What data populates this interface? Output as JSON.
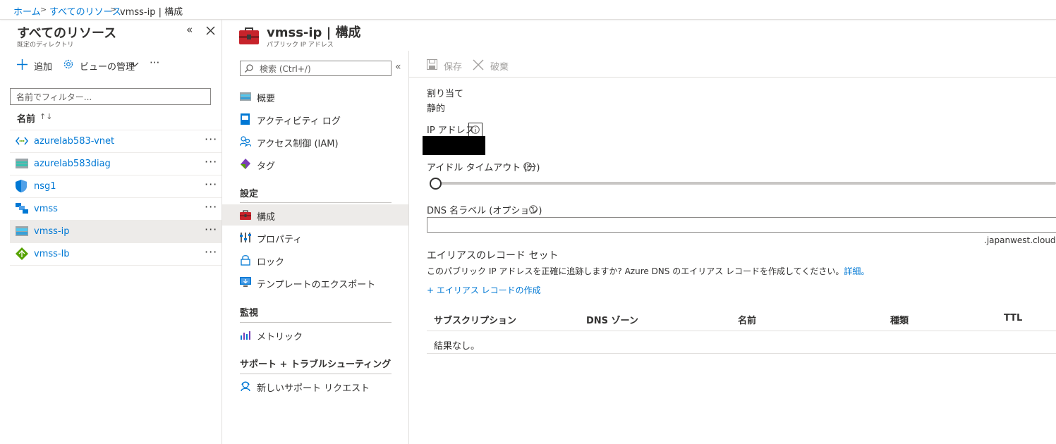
{
  "breadcrumb": {
    "home": "ホーム",
    "all_resources": "すべてのリソース",
    "current": "vmss-ip | 構成"
  },
  "left_pane": {
    "title": "すべてのリソース",
    "subtitle": "既定のディレクトリ",
    "add_label": "追加",
    "manage_view_label": "ビューの管理",
    "more": "···",
    "filter_placeholder": "名前でフィルター...",
    "name_header": "名前",
    "sort_icon": "↑↓",
    "resources": [
      {
        "name": "azurelab583-vnet",
        "icon": "vnet-icon"
      },
      {
        "name": "azurelab583diag",
        "icon": "storage-icon"
      },
      {
        "name": "nsg1",
        "icon": "nsg-shield-icon"
      },
      {
        "name": "vmss",
        "icon": "vmss-icon"
      },
      {
        "name": "vmss-ip",
        "icon": "public-ip-icon",
        "selected": true
      },
      {
        "name": "vmss-lb",
        "icon": "load-balancer-icon"
      }
    ],
    "row_more": "···"
  },
  "blade": {
    "title": "vmss-ip | 構成",
    "subtitle": "パブリック IP アドレス"
  },
  "menu": {
    "search_placeholder": "検索 (Ctrl+/)",
    "collapse": "«",
    "items_top": [
      {
        "label": "概要",
        "icon": "overview-icon"
      },
      {
        "label": "アクティビティ ログ",
        "icon": "activity-log-icon"
      },
      {
        "label": "アクセス制御 (IAM)",
        "icon": "iam-icon"
      },
      {
        "label": "タグ",
        "icon": "tag-icon"
      }
    ],
    "section_settings": "設定",
    "items_settings": [
      {
        "label": "構成",
        "icon": "config-toolbox-icon",
        "selected": true
      },
      {
        "label": "プロパティ",
        "icon": "properties-icon"
      },
      {
        "label": "ロック",
        "icon": "lock-icon"
      },
      {
        "label": "テンプレートのエクスポート",
        "icon": "export-template-icon"
      }
    ],
    "section_monitoring": "監視",
    "items_monitoring": [
      {
        "label": "メトリック",
        "icon": "metrics-icon"
      }
    ],
    "section_support": "サポート + トラブルシューティング",
    "items_support": [
      {
        "label": "新しいサポート リクエスト",
        "icon": "support-request-icon"
      }
    ]
  },
  "toolbar": {
    "save_label": "保存",
    "discard_label": "破棄"
  },
  "form": {
    "assignment_label": "割り当て",
    "assignment_value": "静的",
    "ip_label": "IP アドレス",
    "idle_timeout_label": "アイドル タイムアウト (分)",
    "dns_label": "DNS 名ラベル (オプション)",
    "dns_value": "",
    "dns_suffix": ".japanwest.clouda",
    "alias_heading": "エイリアスのレコード セット",
    "alias_desc": "このパブリック IP アドレスを正確に追跡しますか? Azure DNS のエイリアス レコードを作成してください。",
    "alias_more_link": "詳細。",
    "create_alias": "+ エイリアス レコードの作成",
    "table_headers": [
      "サブスクリプション",
      "DNS ゾーン",
      "名前",
      "種類",
      "TTL"
    ],
    "no_results": "結果なし。",
    "idle_timeout_value": 0
  },
  "colors": {
    "accent": "#0078d4",
    "selected_bg": "#edebe9",
    "redacted": "#000000"
  }
}
